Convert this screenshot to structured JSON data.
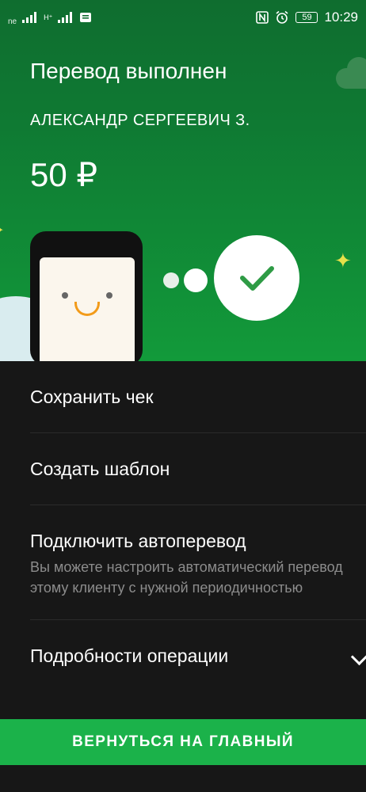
{
  "status_bar": {
    "carrier_hint": "ne",
    "signal_hint": "H⁺",
    "time": "10:29",
    "battery": "59",
    "icons": [
      "signal-icon",
      "nfc-icon",
      "alarm-icon",
      "battery-icon",
      "notification-icon"
    ]
  },
  "header": {
    "title": "Перевод выполнен",
    "recipient": "АЛЕКСАНДР СЕРГЕЕВИЧ З.",
    "amount": "50 ₽"
  },
  "actions": [
    {
      "label": "Сохранить чек"
    },
    {
      "label": "Создать шаблон"
    },
    {
      "label": "Подключить автоперевод",
      "description": "Вы можете настроить автоматический перевод этому клиенту с нужной периодичностью"
    },
    {
      "label": "Подробности операции"
    }
  ],
  "bottom_button": {
    "label": "ВЕРНУТЬСЯ НА ГЛАВНЫЙ"
  },
  "colors": {
    "hero_green": "#129a3a",
    "button_green": "#1bb24a",
    "background": "#171717",
    "check_green": "#2e9b45"
  }
}
